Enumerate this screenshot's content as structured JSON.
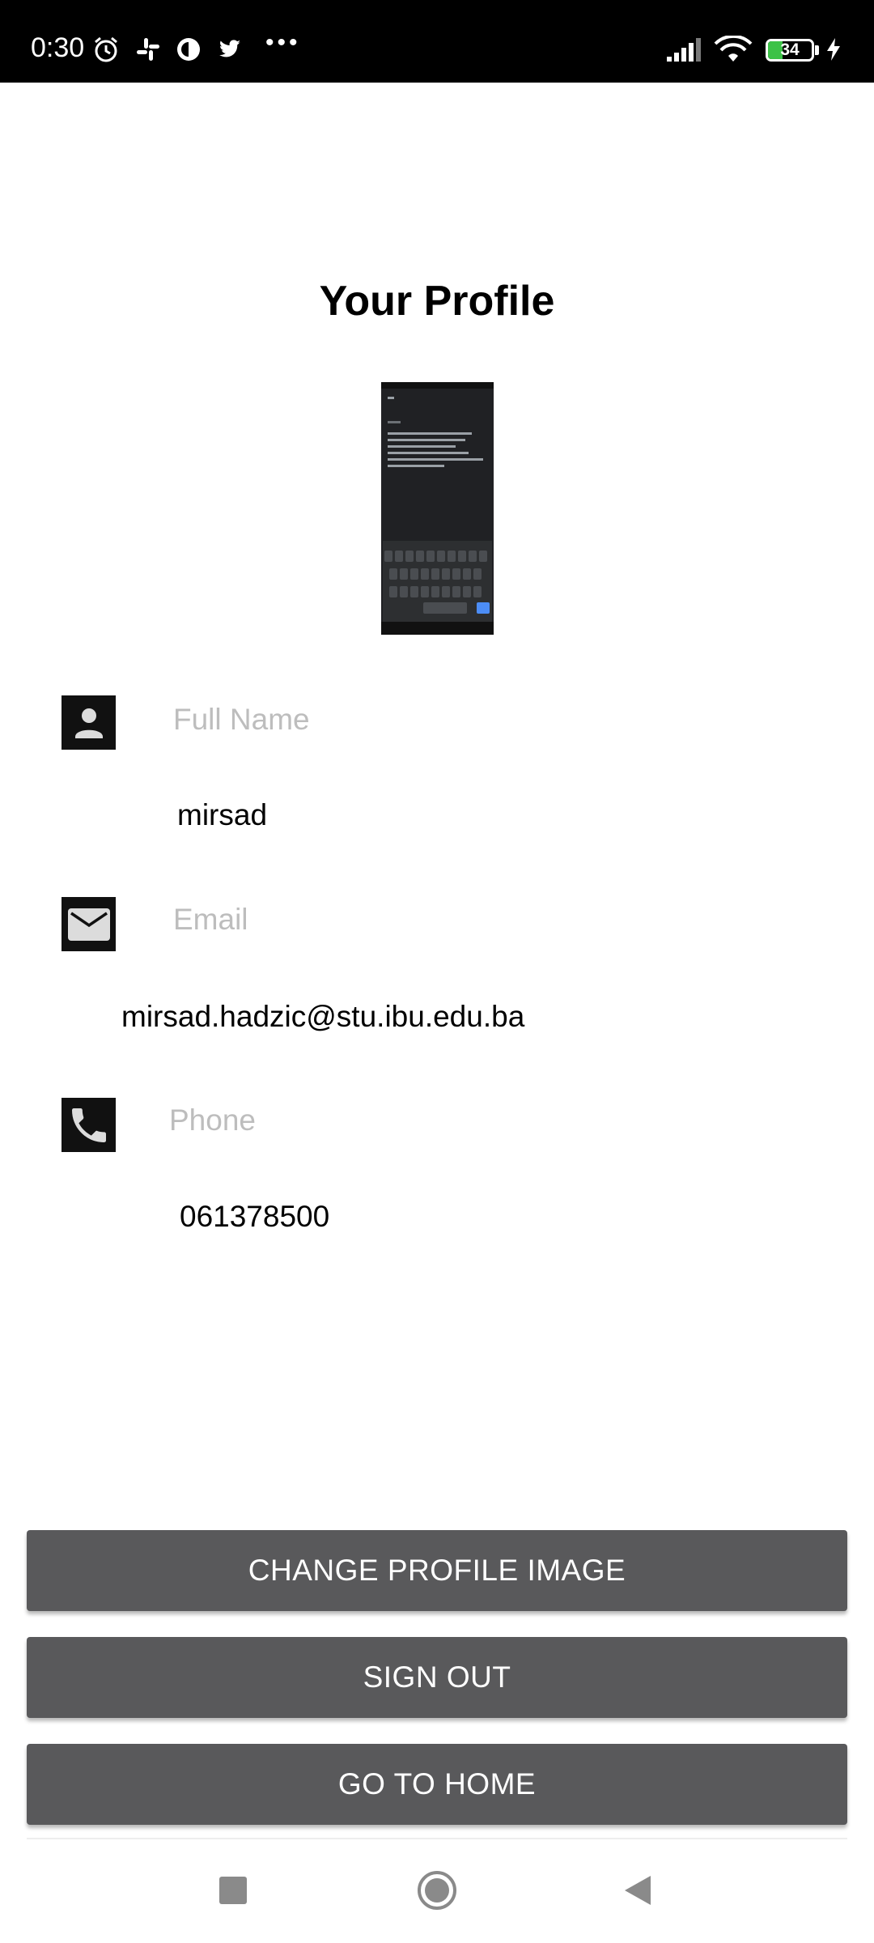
{
  "status_bar": {
    "time": "0:30",
    "battery_level": 34,
    "battery_label": "34",
    "charging": true,
    "icons": [
      "alarm-icon",
      "slack-icon",
      "app-icon",
      "twitter-icon",
      "more-dots-icon",
      "signal-icon",
      "wifi-icon",
      "battery-icon",
      "charging-icon"
    ]
  },
  "page": {
    "title": "Your Profile"
  },
  "fields": {
    "full_name": {
      "label": "Full Name",
      "value": "mirsad",
      "icon": "person-icon"
    },
    "email": {
      "label": "Email",
      "value": "mirsad.hadzic@stu.ibu.edu.ba",
      "icon": "mail-icon"
    },
    "phone": {
      "label": "Phone",
      "value": "061378500",
      "icon": "phone-icon"
    }
  },
  "buttons": {
    "change_image": "CHANGE PROFILE IMAGE",
    "sign_out": "SIGN OUT",
    "go_home": "GO TO HOME"
  },
  "colors": {
    "button_bg": "#59595b",
    "label_gray": "#bdbdbd",
    "battery_green": "#3cc247"
  }
}
